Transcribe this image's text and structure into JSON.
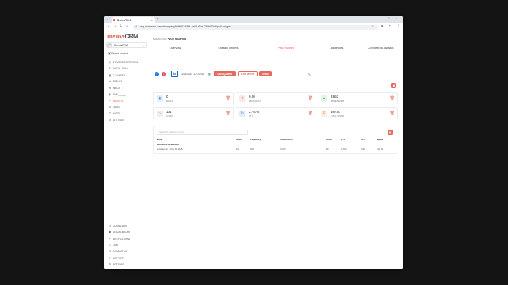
{
  "browser": {
    "tab_title": "MamaCRM",
    "url": "app.mamacrm.com/ct/company/fe9db574-8ff6-4e59-a5ab-790b553a8/paid-insights",
    "new_tab": "+",
    "tab_close": "×",
    "controls": {
      "minimize": "–",
      "maximize": "□",
      "close": "×"
    }
  },
  "sidebar": {
    "logo": {
      "brand": "mama",
      "rest": "CRM"
    },
    "workspace": {
      "name": "MamaCRM",
      "avatar_text": "MAMA"
    },
    "select_project": "Select project",
    "nav_top": [
      {
        "label": "STRATEGIC OVERVIEW",
        "icon": "◎"
      },
      {
        "label": "SOCIAL PLAN",
        "icon": "✎"
      },
      {
        "label": "CALENDAR",
        "icon": "▦"
      },
      {
        "label": "PUBLISH",
        "icon": "➚"
      },
      {
        "label": "INBOX",
        "icon": "✉"
      },
      {
        "label": "ADS",
        "sub": "Campaigns",
        "icon": "◈"
      },
      {
        "label": "INSIGHTS",
        "icon": "◔"
      },
      {
        "label": "TASKS",
        "icon": "☰"
      },
      {
        "label": "NOTES",
        "icon": "✐"
      },
      {
        "label": "SETTINGS",
        "icon": "⚙"
      }
    ],
    "nav_bottom": [
      {
        "label": "DASHBOARD",
        "icon": "▭"
      },
      {
        "label": "MEDIA LIBRARY",
        "icon": "▣"
      },
      {
        "label": "NOTIFICATIONS",
        "icon": "◔"
      },
      {
        "label": "CRM",
        "icon": "☺"
      },
      {
        "label": "CONTACT US",
        "icon": "✉"
      },
      {
        "label": "SUPPORT",
        "icon": "?"
      },
      {
        "label": "SETTINGS",
        "icon": "⚙"
      }
    ]
  },
  "breadcrumb": {
    "parent": "MAMACRM",
    "sep": "/",
    "current": "PAGE INSIGHTS"
  },
  "tabs": [
    "Overview",
    "Organic Insights",
    "Paid Insights",
    "Audiences",
    "Competition Analysis"
  ],
  "filters": {
    "linkedin": "in",
    "date_range": "11/11/2025 - 11/12/2025",
    "last_quarter": "Last Quarter",
    "last_month": "Last Month",
    "share": "Share"
  },
  "stats": [
    {
      "value": "0",
      "label": "REACH",
      "icon": "◉"
    },
    {
      "value": "0.00",
      "label": "FREQUENCY",
      "icon": "✦"
    },
    {
      "value": "3,663",
      "label": "IMPRESSIONS",
      "icon": "▲"
    },
    {
      "value": "101",
      "label": "CLICKS",
      "icon": "↖"
    },
    {
      "value": "2.757%",
      "label": "CTR",
      "icon": "%"
    },
    {
      "value": "100.00",
      "label": "TOTAL SPEND",
      "icon": "$"
    }
  ],
  "table": {
    "search_placeholder": "Search by campaign name",
    "columns": [
      "Name",
      "Reach",
      "Frequency",
      "Impressions",
      "Clicks",
      "CTR",
      "CPC",
      "Spend"
    ],
    "group": "MamaCRM ad account",
    "rows": [
      [
        "Engagement - Nov 30, 2025",
        "N/A",
        "0.00",
        "3,663",
        "101",
        "2.76%",
        "0.99",
        "100.00"
      ]
    ]
  },
  "colors": {
    "accent": "#e5695c",
    "linkedin": "#1a6ab3"
  }
}
